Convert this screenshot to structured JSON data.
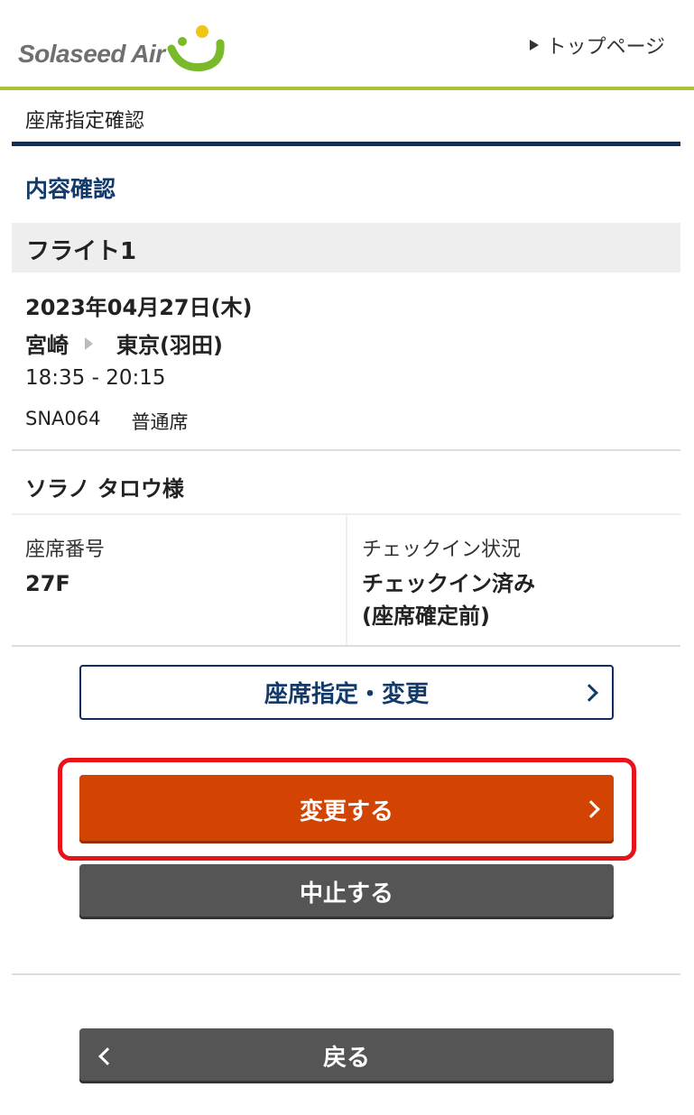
{
  "header": {
    "logo_text": "Solaseed Air",
    "top_link": "トップページ",
    "brand_colors": {
      "logo_green": "#7ab929",
      "logo_yellow": "#f0c417",
      "rule": "#a8c23a"
    }
  },
  "page_title": "座席指定確認",
  "section_heading": "内容確認",
  "flight": {
    "label": "フライト1",
    "date": "2023年04月27日(木)",
    "origin": "宮崎",
    "destination": "東京(羽田)",
    "time": "18:35 - 20:15",
    "flight_number": "SNA064",
    "seat_class": "普通席"
  },
  "passenger": {
    "name": "ソラノ タロウ様",
    "seat_label": "座席番号",
    "seat_value": "27F",
    "checkin_label": "チェックイン状況",
    "checkin_value_line1": "チェックイン済み",
    "checkin_value_line2": "(座席確定前)"
  },
  "buttons": {
    "seat_change": "座席指定・変更",
    "confirm_change": "変更する",
    "cancel": "中止する",
    "back": "戻る"
  },
  "colors": {
    "navy": "#0f2e5e",
    "orange": "#d34403",
    "highlight_red": "#e8121b",
    "gray_button": "#555555"
  }
}
